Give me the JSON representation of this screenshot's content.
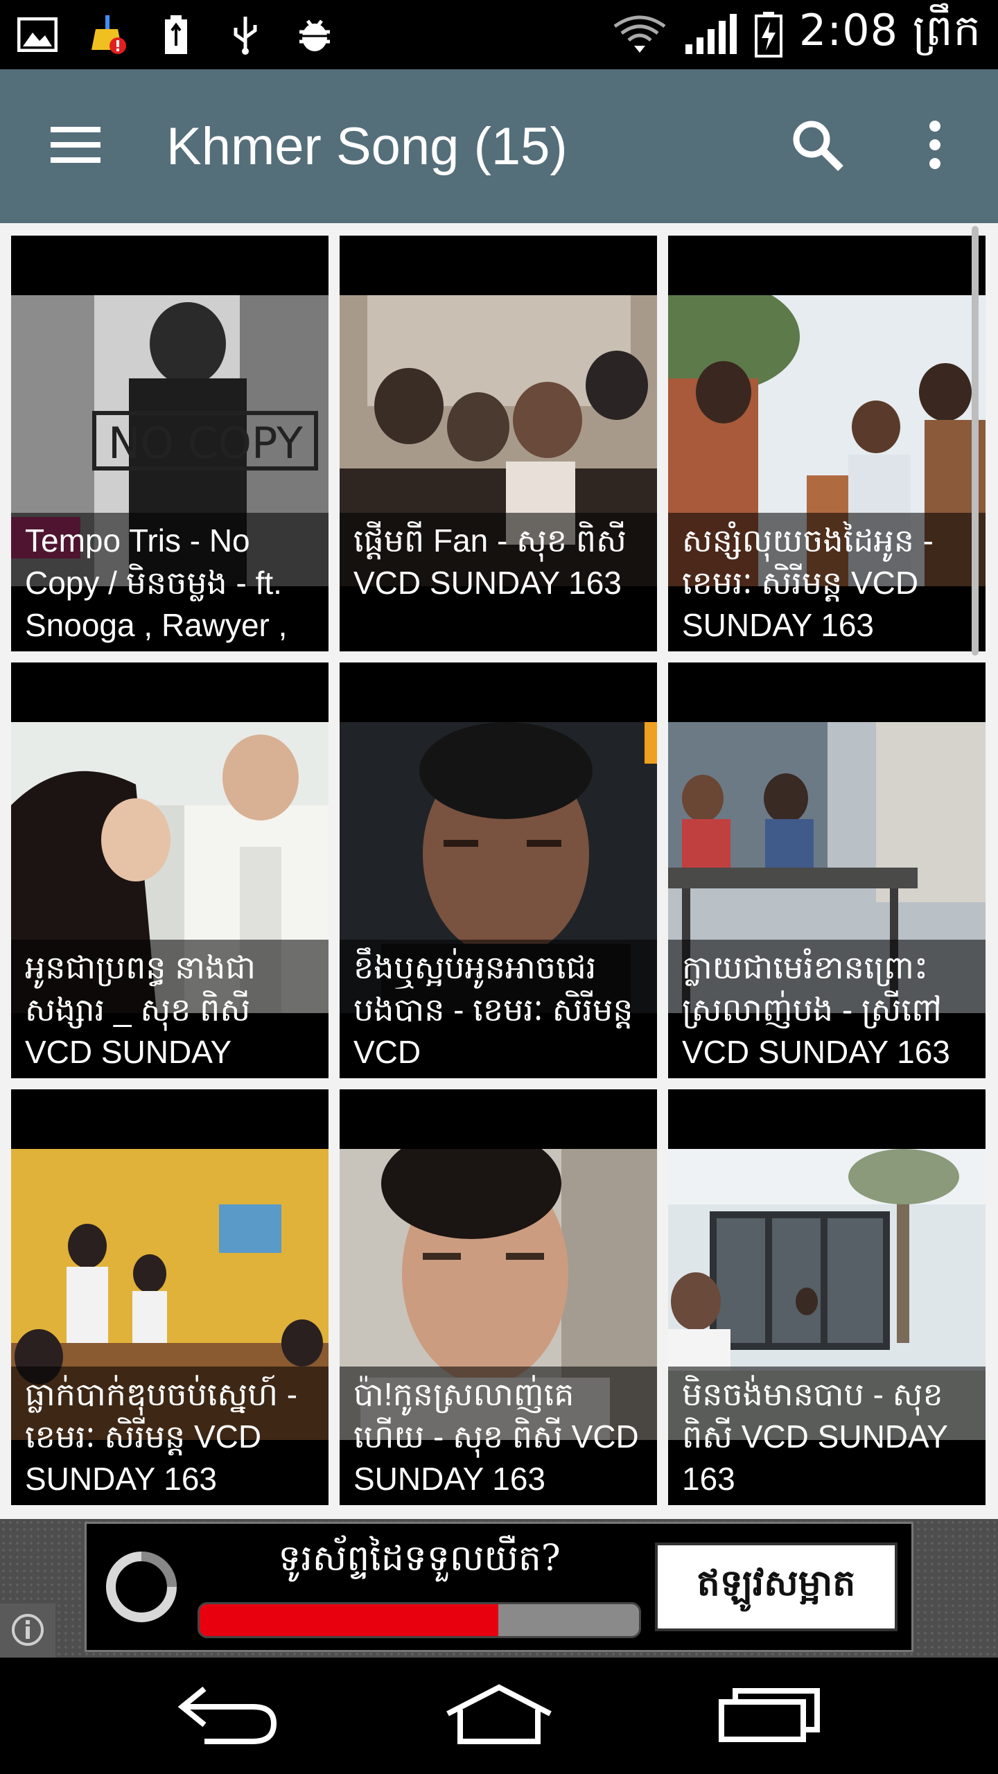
{
  "status_bar": {
    "time": "2:08 ព្រឹក",
    "icons": [
      "gallery-icon",
      "cleaner-alert-icon",
      "battery-usb-icon",
      "usb-icon",
      "android-debug-icon",
      "wifi-icon",
      "cell-signal-icon",
      "battery-charging-icon"
    ]
  },
  "toolbar": {
    "title": "Khmer Song (15)",
    "background": "#546e7a",
    "icons": [
      "menu-icon",
      "search-icon",
      "more-vert-icon"
    ]
  },
  "videos": [
    {
      "title": "Tempo Tris - No Copy / មិនចម្លង - ft. Snooga , Rawyer ,"
    },
    {
      "title": "ផ្ដើមពី Fan - សុខ ពិសី VCD SUNDAY 163"
    },
    {
      "title": "សន្សំលុយចងដៃអូន - ខេមរៈ សិរីមន្ត VCD SUNDAY 163"
    },
    {
      "title": "អូនជាប្រពន្ធ នាងជាសង្សារ _ សុខ ពិសី VCD SUNDAY"
    },
    {
      "title": "ខឹងឬស្អប់អូនអាចជេរ បងបាន - ខេមរៈ សិរីមន្ត VCD"
    },
    {
      "title": "ក្លាយជាមេរំខានព្រោះ ស្រលាញ់បង - ស្រីពៅ VCD SUNDAY 163"
    },
    {
      "title": "ធ្លាក់បាក់ឌុបចប់ស្នេហ៍ - ខេមរៈ សិរីមន្ត VCD SUNDAY 163"
    },
    {
      "title": "ប៉ា!កូនស្រលាញ់គេហើយ - សុខ ពិសី VCD SUNDAY 163"
    },
    {
      "title": "មិនចង់មានបាប - សុខ ពិសី VCD SUNDAY 163"
    }
  ],
  "ad": {
    "question": "ទូរស័ព្ទដៃទទួលយឺត?",
    "cta": "ឥឡូវសម្អាត",
    "progress": 0.68,
    "progress_color": "#e8000e"
  },
  "nav": {
    "icons": [
      "back-icon",
      "home-icon",
      "recents-icon"
    ]
  }
}
